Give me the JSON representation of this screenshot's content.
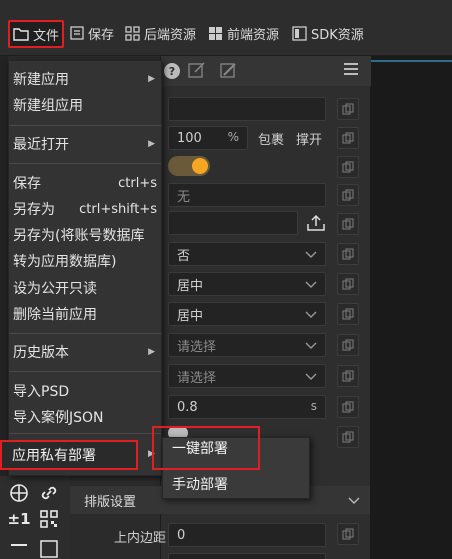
{
  "toolbar": {
    "file": "文件",
    "save": "保存",
    "backend": "后端资源",
    "frontend": "前端资源",
    "sdk": "SDK资源"
  },
  "menu": {
    "new_app": "新建应用",
    "new_group": "新建组应用",
    "recent": "最近打开",
    "save": "保存",
    "save_shortcut": "ctrl+s",
    "save_as": "另存为",
    "save_as_shortcut": "ctrl+shift+s",
    "save_as_account": "另存为(将账号数据库",
    "to_app_db": "转为应用数据库)",
    "public_readonly": "设为公开只读",
    "delete_app": "删除当前应用",
    "history": "历史版本",
    "import_psd": "导入PSD",
    "import_json": "导入案例JSON",
    "private_deploy": "应用私有部署"
  },
  "submenu": {
    "one_click": "一键部署",
    "manual": "手动部署"
  },
  "panel": {
    "width_value": "100",
    "percent": "%",
    "wrap": "包裹",
    "stretch": "撑开",
    "none_value": "无",
    "no_value": "否",
    "center1": "居中",
    "center2": "居中",
    "select1_placeholder": "请选择",
    "select2_placeholder": "请选择",
    "duration_value": "0.8",
    "duration_unit": "s",
    "layout_section": "排版设置",
    "padding_top_label": "上内边距",
    "padding_top_value": "0",
    "toggle_state": "on"
  },
  "icons": {
    "plus_minus": "±1"
  }
}
